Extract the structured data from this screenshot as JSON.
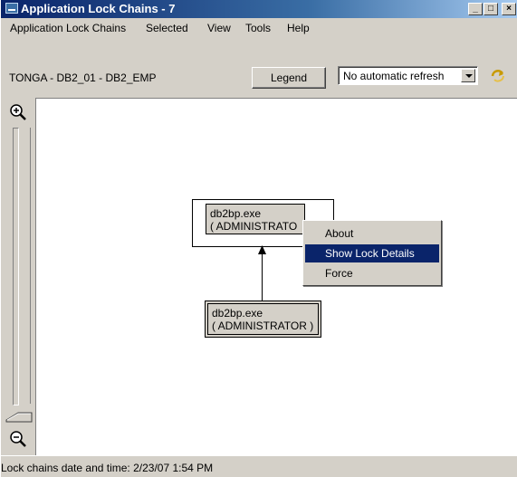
{
  "window": {
    "title": "Application Lock Chains - 7",
    "minimize_label": "_",
    "maximize_label": "□",
    "close_label": "×"
  },
  "menubar": {
    "items": [
      {
        "label": "Application Lock Chains"
      },
      {
        "label": "Selected"
      },
      {
        "label": "View"
      },
      {
        "label": "Tools"
      },
      {
        "label": "Help"
      }
    ]
  },
  "toolbar": {
    "path": "TONGA - DB2_01 - DB2_EMP",
    "legend_label": "Legend",
    "refresh_value": "No automatic refresh"
  },
  "diagram": {
    "nodes": [
      {
        "line1": "db2bp.exe",
        "line2": "( ADMINISTRATO"
      },
      {
        "line1": "db2bp.exe",
        "line2": "( ADMINISTRATOR )"
      }
    ]
  },
  "context_menu": {
    "items": [
      {
        "label": "About"
      },
      {
        "label": "Show Lock Details"
      },
      {
        "label": "Force"
      }
    ],
    "selected_index": 1
  },
  "status": {
    "text": "Lock chains date and time: 2/23/07 1:54 PM"
  },
  "icons": {
    "app": "lock-chains-app-icon",
    "refresh": "refresh-arrow-icon",
    "zoom_in": "zoom-in-icon",
    "zoom_out": "zoom-out-icon"
  },
  "colors": {
    "title_bar": "#0a246a",
    "selection": "#0a246a",
    "face": "#d4d0c8"
  }
}
